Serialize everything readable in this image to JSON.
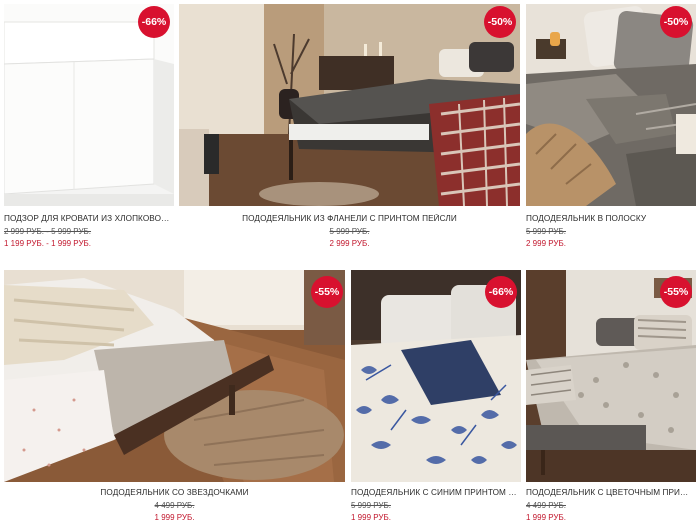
{
  "colors": {
    "badge": "#d8112f",
    "sale_price": "#c2182e",
    "old_price": "#555555"
  },
  "products": [
    {
      "badge": "-66%",
      "title": "ПОДЗОР ДЛЯ КРОВАТИ ИЗ ХЛОПКОВОГО П...",
      "old_price": "2 999 РУБ. - 5 999 РУБ.",
      "new_price": "1 199 РУБ. - 1 999 РУБ."
    },
    {
      "badge": "-50%",
      "title": "ПОДОДЕЯЛЬНИК ИЗ ФЛАНЕЛИ С ПРИНТОМ ПЕЙСЛИ",
      "old_price": "5 999 РУБ.",
      "new_price": "2 999 РУБ."
    },
    {
      "badge": "-50%",
      "title": "ПОДОДЕЯЛЬНИК В ПОЛОСКУ",
      "old_price": "5 999 РУБ.",
      "new_price": "2 999 РУБ."
    },
    {
      "badge": "-55%",
      "title": "ПОДОДЕЯЛЬНИК СО ЗВЕЗДОЧКАМИ",
      "old_price": "4 499 РУБ.",
      "new_price": "1 999 РУБ."
    },
    {
      "badge": "-66%",
      "title": "ПОДОДЕЯЛЬНИК С СИНИМ ПРИНТОМ «ПА...",
      "old_price": "5 999 РУБ.",
      "new_price": "1 999 РУБ."
    },
    {
      "badge": "-55%",
      "title": "ПОДОДЕЯЛЬНИК С ЦВЕТОЧНЫМ ПРИНТОМ",
      "old_price": "4 499 РУБ.",
      "new_price": "1 999 РУБ."
    }
  ]
}
